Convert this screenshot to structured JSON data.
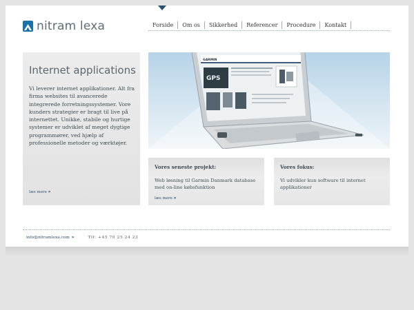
{
  "brand": {
    "name": "nitram lexa",
    "accent": "#2c5170",
    "mark_color": "#1a72aa"
  },
  "nav": {
    "items": [
      {
        "label": "Forside"
      },
      {
        "label": "Om os"
      },
      {
        "label": "Sikkerhed"
      },
      {
        "label": "Referencer"
      },
      {
        "label": "Procedure"
      },
      {
        "label": "Kontakt"
      }
    ]
  },
  "intro": {
    "title": "Internet applications",
    "text": "Vi leverer internet applikationer. Alt fra firma websites til avancerede integrerede forretningssystemer. Vore kunders strategier er bragt til live på internettet. Unikke, stabile og hurtige systemer er udviklet af meget dygtige programmører, ved hjælp af professionelle metoder og værktøjer.",
    "read_more": "læs mere",
    "read_more_arrow": "»"
  },
  "hero": {
    "screen_brand": "GARMIN",
    "screen_badge": "GPS"
  },
  "cards": [
    {
      "title": "Vores seneste projekt:",
      "text": "Web løsning til Garmin Danmark database med on-line købsfunktion",
      "read_more": "læs mere",
      "read_more_arrow": "»"
    },
    {
      "title": "Vores fokus:",
      "text": "Vi udvikler kun software til internet applikationer"
    }
  ],
  "footer": {
    "email": "info@nitramlexa.com",
    "email_arrow": "»",
    "tel": "Tlf: +45 70 25 24 23"
  }
}
